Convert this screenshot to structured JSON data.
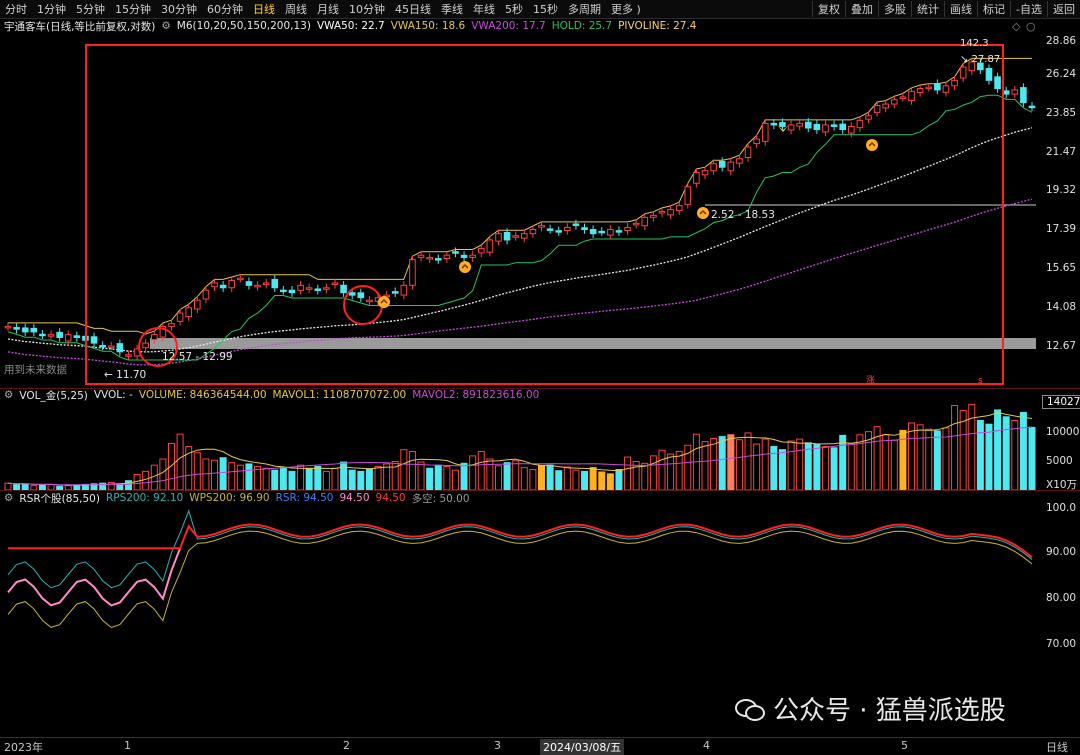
{
  "toolbar": {
    "tabs": [
      "分时",
      "1分钟",
      "5分钟",
      "15分钟",
      "30分钟",
      "60分钟",
      "日线",
      "周线",
      "月线",
      "10分钟",
      "45日线",
      "季线",
      "年线",
      "5秒",
      "15秒",
      "多周期",
      "更多 )"
    ],
    "active_tab": "日线",
    "right_buttons": [
      "复权",
      "叠加",
      "多股",
      "统计",
      "画线",
      "标记",
      "-自选",
      "返回"
    ]
  },
  "main_header": {
    "stock": "宇通客车(日线,等比前复权,对数)",
    "indicator": "M6(10,20,50,150,200,13)",
    "vwa50": "VWA50: 22.7",
    "vwa150": "VWA150: 18.6",
    "vwa200": "VWA200: 17.7",
    "hold": "HOLD: 25.7",
    "pivoline": "PIVOLINE: 27.4",
    "colors": {
      "vwa50": "#ffffff",
      "vwa150": "#e6c84a",
      "vwa200": "#c84bdc",
      "hold": "#22c55e",
      "pivoline": "#ffd166"
    }
  },
  "price_axis": [
    "28.86",
    "26.24",
    "23.85",
    "21.47",
    "19.32",
    "17.39",
    "15.65",
    "14.08",
    "12.67"
  ],
  "price_labels": {
    "high": "142.3",
    "pivot": "27.87",
    "range_1": "12.57 - 12.99",
    "range_2": "2.52 - 18.53",
    "low": "11.70",
    "future_text": "用到未来数据",
    "marker_1": "涨",
    "marker_2": "s"
  },
  "vol_header": {
    "name": "VOL_金(5,25)",
    "vvol": "VVOL: -",
    "volume": "VOLUME: 846364544.00",
    "mavol1": "MAVOL1: 1108707072.00",
    "mavol2": "MAVOL2: 891823616.00"
  },
  "vol_axis": {
    "top": "14027",
    "a": "10000",
    "b": "5000",
    "unit": "X10万"
  },
  "rsr_header": {
    "name": "RSR个股(85,50)",
    "rps200": "RPS200: 92.10",
    "wps200": "WPS200: 96.90",
    "rsr": "RSR: 94.50",
    "v4": "94.50",
    "v5": "94.50",
    "duokong": "多空: 50.00"
  },
  "rsr_axis": [
    "100.0",
    "90.00",
    "80.00",
    "70.00"
  ],
  "bottom_axis": {
    "year": "2023年",
    "m1": "1",
    "m2": "2",
    "m3": "3",
    "date": "2024/03/08/五",
    "m4": "4",
    "m5": "5",
    "period": "日线"
  },
  "watermark": "公众号 · 猛兽派选股",
  "chart_data": {
    "type": "candlestick",
    "price_scale": "log",
    "ylim": [
      11.2,
      29.5
    ],
    "ohlc_close_estimate": [
      12.9,
      12.8,
      12.7,
      12.7,
      12.6,
      12.6,
      12.5,
      12.6,
      12.5,
      12.4,
      12.3,
      12.2,
      12.2,
      12.0,
      11.9,
      12.1,
      12.3,
      12.6,
      12.9,
      13.0,
      13.4,
      13.6,
      13.9,
      14.3,
      14.6,
      14.4,
      14.7,
      14.8,
      14.5,
      14.5,
      14.6,
      14.4,
      14.3,
      14.2,
      14.5,
      14.4,
      14.3,
      14.4,
      14.6,
      14.2,
      14.1,
      14.0,
      13.9,
      14.0,
      14.1,
      14.2,
      14.5,
      15.6,
      15.8,
      15.7,
      15.6,
      15.8,
      15.9,
      15.7,
      15.8,
      16.1,
      16.5,
      16.8,
      16.5,
      16.7,
      16.8,
      17.0,
      17.2,
      17.0,
      16.9,
      17.1,
      17.2,
      17.0,
      16.8,
      16.9,
      17.0,
      16.9,
      17.1,
      17.3,
      17.6,
      17.7,
      17.9,
      18.0,
      18.2,
      19.2,
      20.0,
      20.1,
      20.5,
      20.3,
      20.6,
      20.8,
      21.5,
      22.0,
      23.0,
      22.9,
      22.8,
      22.9,
      23.0,
      22.7,
      22.6,
      22.9,
      22.8,
      22.6,
      22.8,
      23.2,
      23.5,
      24.2,
      24.3,
      24.6,
      24.8,
      25.2,
      25.4,
      25.5,
      25.3,
      25.6,
      26.0,
      27.0,
      27.4,
      26.8,
      26.0,
      25.4,
      25.0,
      25.3,
      24.4,
      24.1
    ],
    "volume_estimate_x10wan": [
      1100,
      900,
      1000,
      700,
      800,
      900,
      600,
      700,
      800,
      900,
      1000,
      1100,
      1200,
      1000,
      1500,
      2500,
      3000,
      4000,
      5000,
      7500,
      9000,
      7000,
      6000,
      5000,
      4800,
      5200,
      4400,
      4000,
      4200,
      3800,
      3500,
      3200,
      3600,
      3000,
      4000,
      3500,
      3800,
      3000,
      3500,
      4500,
      3200,
      3000,
      3400,
      3800,
      4200,
      4600,
      6500,
      6200,
      4500,
      3500,
      4000,
      3800,
      3200,
      4300,
      5500,
      6200,
      5000,
      3900,
      4400,
      4700,
      3600,
      3300,
      3900,
      4000,
      3100,
      3700,
      3200,
      3000,
      3600,
      2900,
      2600,
      3300,
      5300,
      4600,
      4300,
      5500,
      6400,
      5800,
      6200,
      7200,
      9000,
      7800,
      8300,
      8600,
      8900,
      8100,
      9200,
      7400,
      8200,
      7000,
      6500,
      7900,
      8200,
      7600,
      7400,
      7000,
      6800,
      8800,
      7500,
      8900,
      9400,
      10200,
      8900,
      8000,
      9600,
      10800,
      10500,
      9800,
      9500,
      10000,
      13600,
      12800,
      13800,
      11200,
      10600,
      12900,
      11800,
      11200,
      12500,
      10100
    ]
  }
}
